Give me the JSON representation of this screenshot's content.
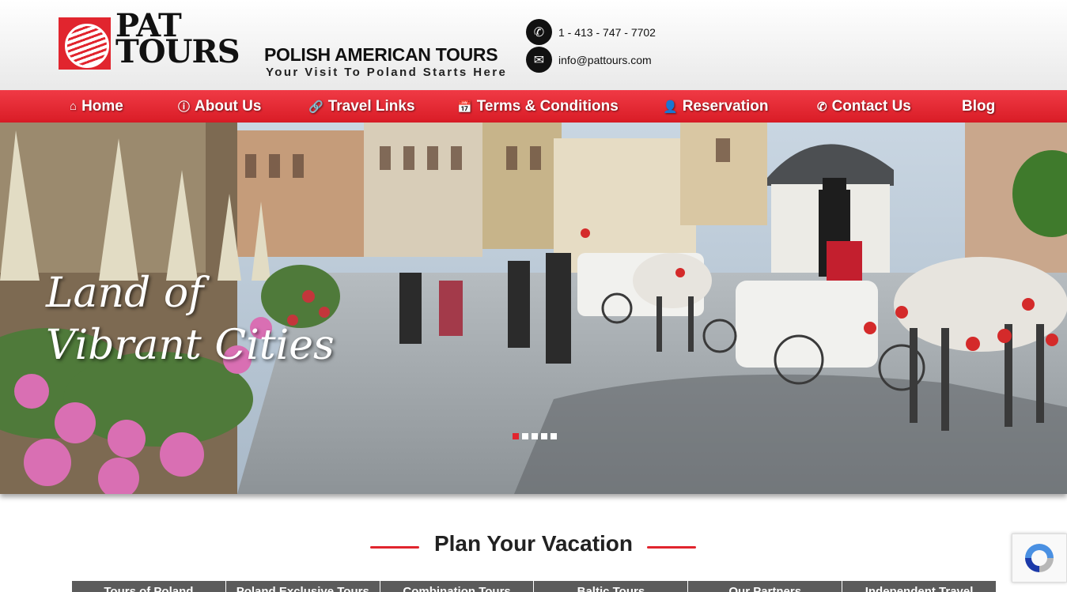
{
  "header": {
    "logo_text_line1": "PAT",
    "logo_text_line2": "TOURS",
    "brand_name": "POLISH AMERICAN TOURS",
    "tagline": "Your Visit To Poland Starts Here",
    "phone": "1 - 413 - 747 - 7702",
    "email": "info@pattours.com",
    "phone_icon": "phone-icon",
    "email_icon": "envelope-icon"
  },
  "nav": {
    "items": [
      {
        "label": "Home",
        "icon": "home-icon"
      },
      {
        "label": "About Us",
        "icon": "info-icon"
      },
      {
        "label": "Travel Links",
        "icon": "link-icon"
      },
      {
        "label": "Terms & Conditions",
        "icon": "calendar-icon"
      },
      {
        "label": "Reservation",
        "icon": "user-check-icon"
      },
      {
        "label": "Contact Us",
        "icon": "phone-icon"
      },
      {
        "label": "Blog",
        "icon": ""
      }
    ]
  },
  "hero": {
    "caption_line1": "Land of",
    "caption_line2": "Vibrant Cities",
    "slide_count": 5,
    "active_slide": 1
  },
  "plan": {
    "title": "Plan Your Vacation",
    "tabs": [
      "Tours of Poland",
      "Poland Exclusive Tours",
      "Combination Tours",
      "Baltic Tours",
      "Our Partners",
      "Independent Travel"
    ]
  },
  "colors": {
    "accent": "#e1252e",
    "nav_bg": "#e8262f",
    "tab_bg": "#5b5b5b",
    "text_dark": "#111111"
  }
}
